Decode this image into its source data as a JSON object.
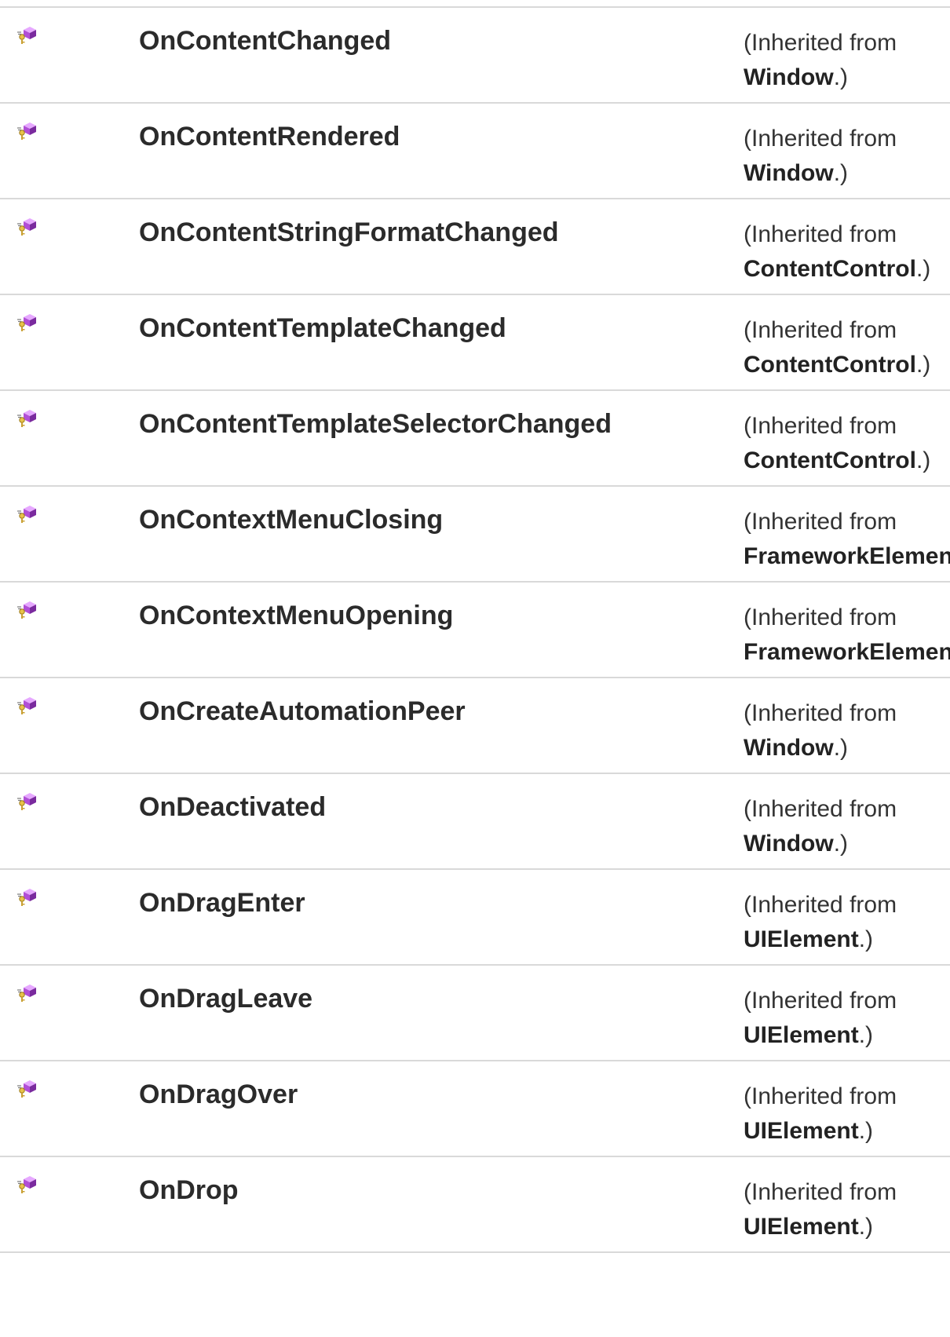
{
  "icon": "protected-method-icon",
  "inherited_prefix": "(Inherited from",
  "period_suffix": ".)",
  "rows": [
    {
      "name": "OnContentChanged",
      "from": "Window"
    },
    {
      "name": "OnContentRendered",
      "from": "Window"
    },
    {
      "name": "OnContentStringFormatChanged",
      "from": "ContentControl"
    },
    {
      "name": "OnContentTemplateChanged",
      "from": "ContentControl"
    },
    {
      "name": "OnContentTemplateSelectorChanged",
      "from": "ContentControl"
    },
    {
      "name": "OnContextMenuClosing",
      "from": "FrameworkElement"
    },
    {
      "name": "OnContextMenuOpening",
      "from": "FrameworkElement"
    },
    {
      "name": "OnCreateAutomationPeer",
      "from": "Window"
    },
    {
      "name": "OnDeactivated",
      "from": "Window"
    },
    {
      "name": "OnDragEnter",
      "from": "UIElement"
    },
    {
      "name": "OnDragLeave",
      "from": "UIElement"
    },
    {
      "name": "OnDragOver",
      "from": "UIElement"
    },
    {
      "name": "OnDrop",
      "from": "UIElement"
    }
  ]
}
